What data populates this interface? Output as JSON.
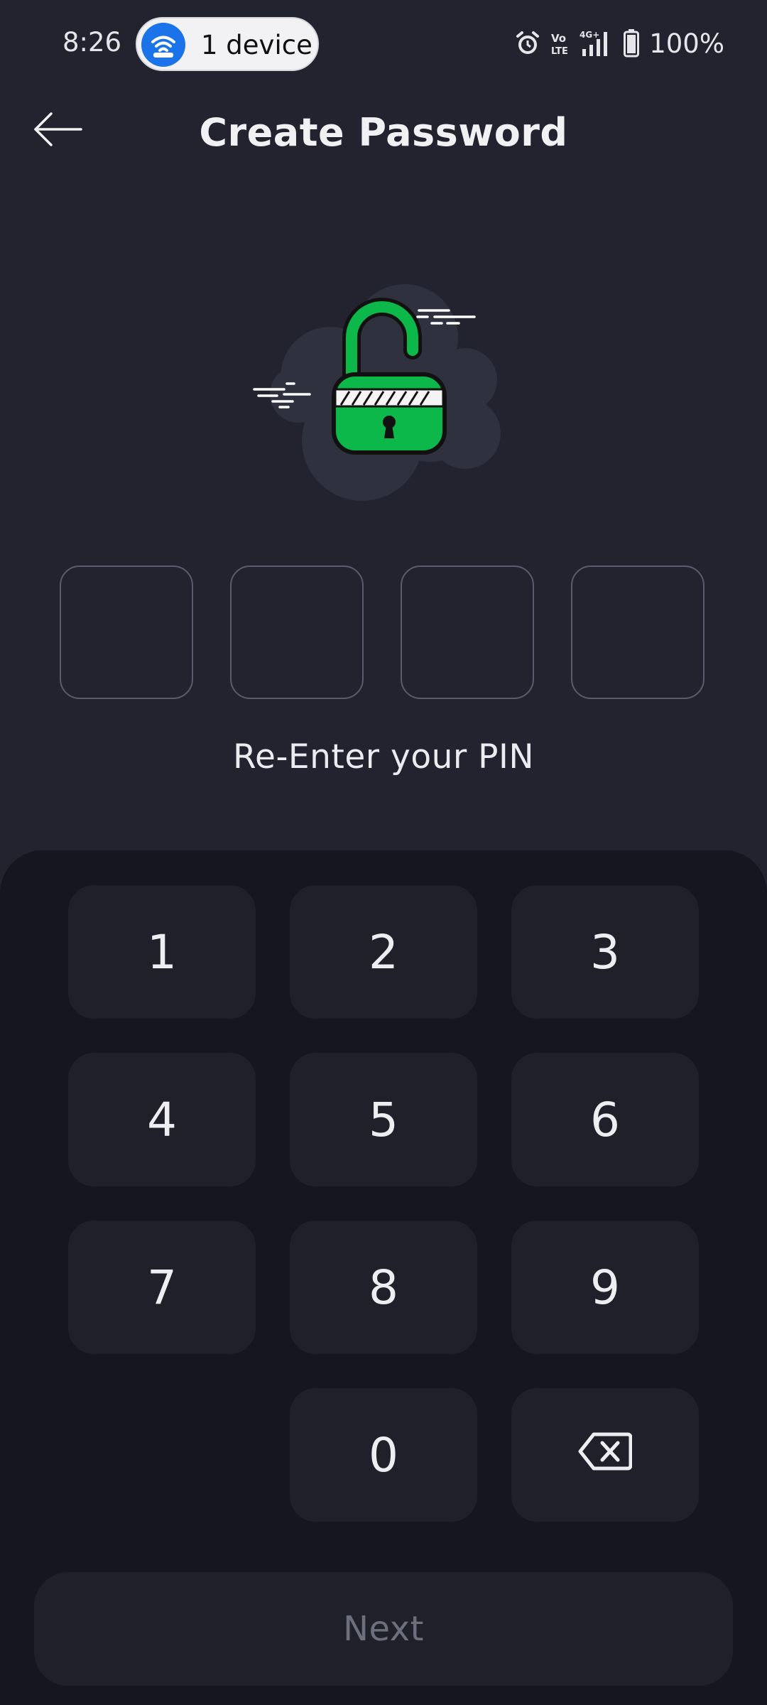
{
  "status_bar": {
    "time": "8:26",
    "hotspot_label": "1 device",
    "battery": "100%",
    "icons": [
      "wifi-hotspot-icon",
      "alarm-icon",
      "volte-icon",
      "4g-signal-icon",
      "battery-icon"
    ]
  },
  "header": {
    "title": "Create Password",
    "back_icon": "arrow-left-icon"
  },
  "illustration": {
    "icon": "unlocked-padlock-icon",
    "accent_color": "#0cb84a"
  },
  "pin": {
    "length": 4,
    "entered": [
      "",
      "",
      "",
      ""
    ],
    "instruction": "Re-Enter your PIN"
  },
  "keypad": {
    "keys": [
      "1",
      "2",
      "3",
      "4",
      "5",
      "6",
      "7",
      "8",
      "9",
      "0"
    ],
    "backspace_icon": "backspace-icon"
  },
  "actions": {
    "next_label": "Next",
    "next_enabled": false
  },
  "colors": {
    "background": "#22232f",
    "keypad_background": "#151620",
    "key_background": "#1f2029",
    "pin_border": "#5a5b6c",
    "disabled_text": "#6e6f7c",
    "hotspot_blue": "#1a73e8"
  }
}
